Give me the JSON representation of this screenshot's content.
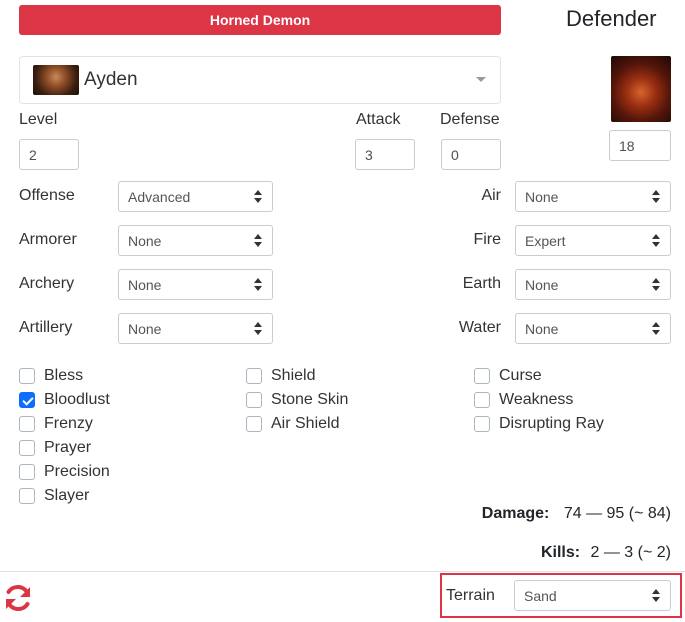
{
  "unit": {
    "name": "Horned Demon"
  },
  "side": {
    "title": "Defender"
  },
  "hero": {
    "name": "Ayden"
  },
  "stats": {
    "level_label": "Level",
    "level_value": "2",
    "attack_label": "Attack",
    "attack_value": "3",
    "defense_label": "Defense",
    "defense_value": "0",
    "creature_count": "18"
  },
  "skills_left": [
    {
      "label": "Offense",
      "value": "Advanced"
    },
    {
      "label": "Armorer",
      "value": "None"
    },
    {
      "label": "Archery",
      "value": "None"
    },
    {
      "label": "Artillery",
      "value": "None"
    }
  ],
  "skills_right": [
    {
      "label": "Air",
      "value": "None"
    },
    {
      "label": "Fire",
      "value": "Expert"
    },
    {
      "label": "Earth",
      "value": "None"
    },
    {
      "label": "Water",
      "value": "None"
    }
  ],
  "spells": {
    "col1": [
      {
        "label": "Bless",
        "checked": false
      },
      {
        "label": "Bloodlust",
        "checked": true
      },
      {
        "label": "Frenzy",
        "checked": false
      },
      {
        "label": "Prayer",
        "checked": false
      },
      {
        "label": "Precision",
        "checked": false
      },
      {
        "label": "Slayer",
        "checked": false
      }
    ],
    "col2": [
      {
        "label": "Shield",
        "checked": false
      },
      {
        "label": "Stone Skin",
        "checked": false
      },
      {
        "label": "Air Shield",
        "checked": false
      }
    ],
    "col3": [
      {
        "label": "Curse",
        "checked": false
      },
      {
        "label": "Weakness",
        "checked": false
      },
      {
        "label": "Disrupting Ray",
        "checked": false
      }
    ]
  },
  "results": {
    "damage_label": "Damage:",
    "damage_value": "74 — 95 (~ 84)",
    "kills_label": "Kills:",
    "kills_value": "2 — 3 (~ 2)"
  },
  "terrain": {
    "label": "Terrain",
    "value": "Sand"
  },
  "colors": {
    "accent": "#dc3545",
    "checkbox": "#0d6efd"
  },
  "icons": {
    "refresh": "refresh-icon"
  }
}
